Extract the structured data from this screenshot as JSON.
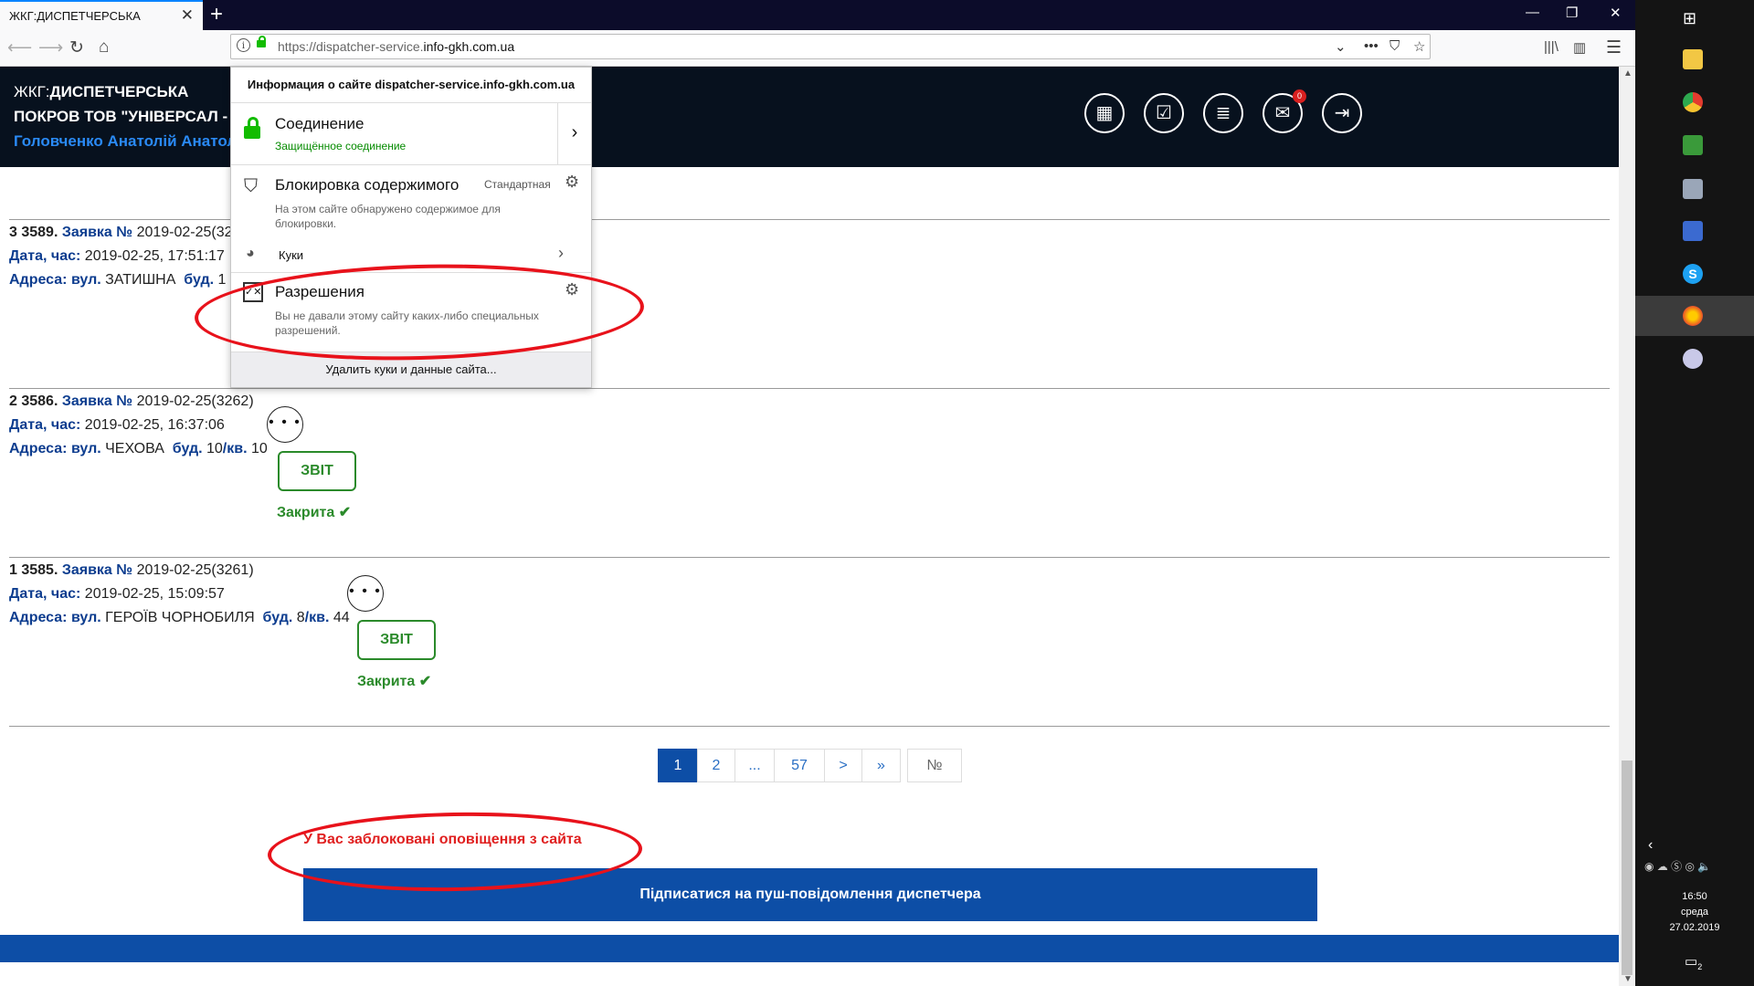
{
  "browser": {
    "tab_title": "ЖКГ:ДИСПЕТЧЕРСЬКА",
    "tab_close": "✕",
    "new_tab": "+",
    "url_prefix": "https://dispatcher-service.",
    "url_domain": "info-gkh.com.ua",
    "info_icon": "i"
  },
  "header": {
    "line1_prefix": "ЖКГ:",
    "line1_rest": "ДИСПЕТЧЕРСЬКА",
    "line2": "ПОКРОВ ТОВ \"УНІВЕРСАЛ - СЕ",
    "line3": "Головченко Анатолій Анатолі",
    "notifications_count": "0"
  },
  "popup": {
    "title": "Информация о сайте dispatcher-service.info-gkh.com.ua",
    "connection_title": "Соединение",
    "connection_status": "Защищённое соединение",
    "blocking_title": "Блокировка содержимого",
    "blocking_mode": "Стандартная",
    "blocking_desc": "На этом сайте обнаружено содержимое для блокировки.",
    "cookies_label": "Куки",
    "permissions_title": "Разрешения",
    "permissions_desc": "Вы не давали этому сайту каких-либо специальных разрешений.",
    "clear_button": "Удалить куки и данные сайта..."
  },
  "labels": {
    "request": "Заявка №",
    "datetime": "Дата, час:",
    "address": "Адреса:",
    "street": "вул.",
    "building": "буд.",
    "apartment": "кв.",
    "report": "ЗВІТ",
    "closed": "Закрита",
    "check": "✔",
    "more": "• • •"
  },
  "requests": [
    {
      "num": "3 3589",
      "id": "2019-02-25(32",
      "datetime": "2019-02-25, 17:51:17",
      "street": "ЗАТИШНА",
      "building": "1"
    },
    {
      "num": "2 3586",
      "id": "2019-02-25(3262)",
      "datetime": "2019-02-25, 16:37:06",
      "street": "ЧЕХОВА",
      "building": "10",
      "apt": "10"
    },
    {
      "num": "1 3585",
      "id": "2019-02-25(3261)",
      "datetime": "2019-02-25, 15:09:57",
      "street": "ГЕРОЇВ ЧОРНОБИЛЯ",
      "building": "8",
      "apt": "44"
    }
  ],
  "pagination": [
    "1",
    "2",
    "...",
    "57",
    ">",
    "»",
    "№"
  ],
  "notice": {
    "blocked_text": "У Вас заблоковані оповіщення з сайта",
    "subscribe_button": "Підписатися на пуш-повідомлення диспетчера"
  },
  "taskbar": {
    "time": "16:50",
    "day": "среда",
    "date": "27.02.2019",
    "notif_count": "2"
  }
}
